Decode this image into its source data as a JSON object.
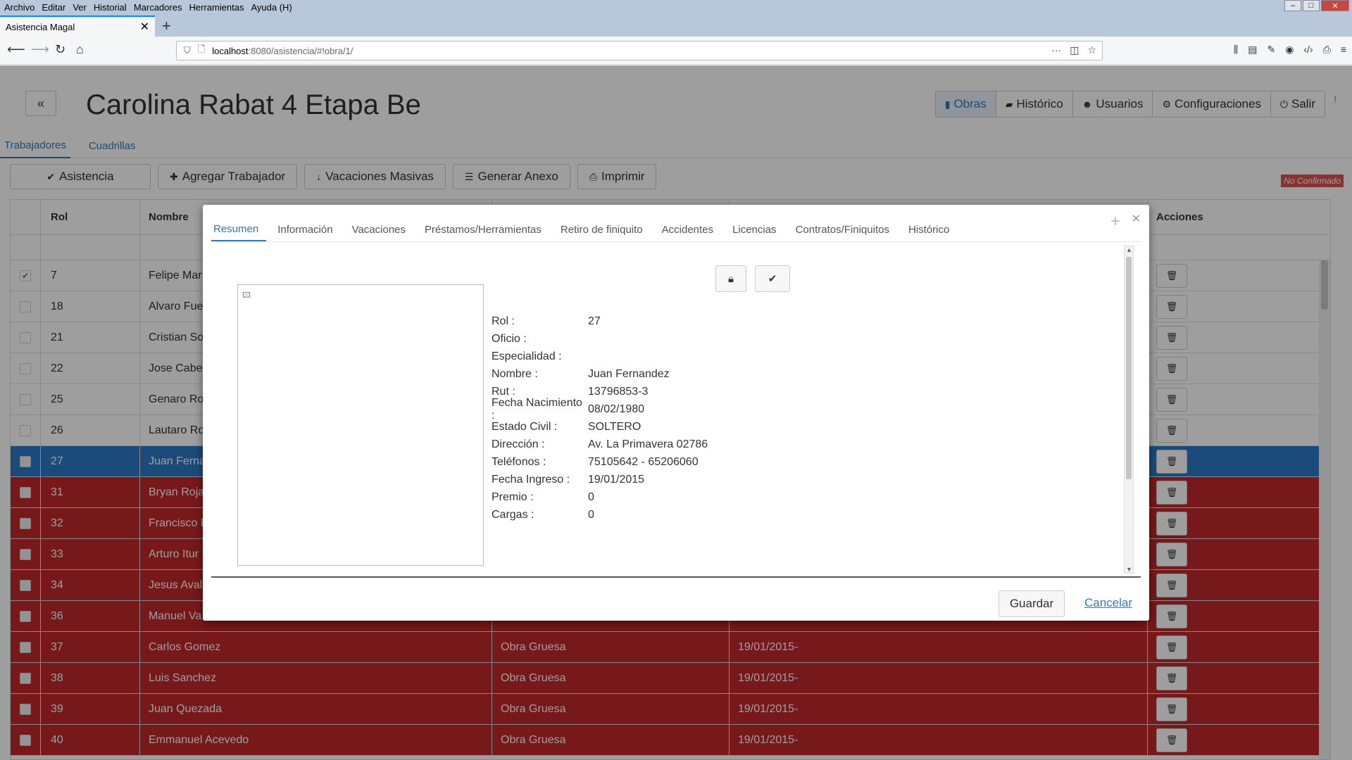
{
  "browser": {
    "menu": [
      "Archivo",
      "Editar",
      "Ver",
      "Historial",
      "Marcadores",
      "Herramientas",
      "Ayuda (H)"
    ],
    "tab_title": "Asistencia Magal",
    "url_host": "localhost",
    "url_path": ":8080/asistencia/#!obra/1/"
  },
  "page": {
    "title": "Carolina Rabat 4 Etapa Be",
    "back_label": "«",
    "nav": [
      "Obras",
      "Histórico",
      "Usuarios",
      "Configuraciones",
      "Salir"
    ],
    "alert_mark": "!",
    "subtabs": [
      "Trabajadores",
      "Cuadrillas"
    ],
    "toolbar": [
      "Asistencia",
      "Agregar Trabajador",
      "Vacaciones Masivas",
      "Generar Anexo",
      "Imprimir"
    ],
    "status_badge": "No Confirmado"
  },
  "grid": {
    "headers": [
      "Rol",
      "Nombre",
      "Acciones"
    ],
    "rows": [
      {
        "rol": "7",
        "nombre": "Felipe Mar",
        "oficio": "",
        "fecha": "",
        "state": "normal",
        "checked": true
      },
      {
        "rol": "18",
        "nombre": "Alvaro Fue",
        "oficio": "",
        "fecha": "",
        "state": "normal",
        "checked": false
      },
      {
        "rol": "21",
        "nombre": "Cristian So",
        "oficio": "",
        "fecha": "",
        "state": "normal",
        "checked": false
      },
      {
        "rol": "22",
        "nombre": "Jose Cabez",
        "oficio": "",
        "fecha": "",
        "state": "normal",
        "checked": false
      },
      {
        "rol": "25",
        "nombre": "Genaro Ro",
        "oficio": "",
        "fecha": "",
        "state": "normal",
        "checked": false
      },
      {
        "rol": "26",
        "nombre": "Lautaro Ro",
        "oficio": "",
        "fecha": "",
        "state": "normal",
        "checked": false
      },
      {
        "rol": "27",
        "nombre": "Juan Ferna",
        "oficio": "",
        "fecha": "",
        "state": "selected",
        "checked": false
      },
      {
        "rol": "31",
        "nombre": "Bryan Roja",
        "oficio": "",
        "fecha": "",
        "state": "red",
        "checked": false
      },
      {
        "rol": "32",
        "nombre": "Francisco E",
        "oficio": "",
        "fecha": "",
        "state": "red",
        "checked": false
      },
      {
        "rol": "33",
        "nombre": "Arturo Itur",
        "oficio": "",
        "fecha": "",
        "state": "red",
        "checked": false
      },
      {
        "rol": "34",
        "nombre": "Jesus Avalo",
        "oficio": "",
        "fecha": "",
        "state": "red",
        "checked": false
      },
      {
        "rol": "36",
        "nombre": "Manuel Va",
        "oficio": "",
        "fecha": "",
        "state": "red",
        "checked": false
      },
      {
        "rol": "37",
        "nombre": "Carlos Gomez",
        "oficio": "Obra Gruesa",
        "fecha": "19/01/2015-",
        "state": "red",
        "checked": false
      },
      {
        "rol": "38",
        "nombre": "Luis Sanchez",
        "oficio": "Obra Gruesa",
        "fecha": "19/01/2015-",
        "state": "red",
        "checked": false
      },
      {
        "rol": "39",
        "nombre": "Juan Quezada",
        "oficio": "Obra Gruesa",
        "fecha": "19/01/2015-",
        "state": "red",
        "checked": false
      },
      {
        "rol": "40",
        "nombre": "Emmanuel Acevedo",
        "oficio": "Obra Gruesa",
        "fecha": "19/01/2015-",
        "state": "red",
        "checked": false
      }
    ]
  },
  "modal": {
    "tabs": [
      "Resumen",
      "Información",
      "Vacaciones",
      "Préstamos/Herramientas",
      "Retiro de finiquito",
      "Accidentes",
      "Licencias",
      "Contratos/Finiquitos",
      "Histórico"
    ],
    "fields": [
      {
        "label": "Rol :",
        "value": "27"
      },
      {
        "label": "Oficio :",
        "value": ""
      },
      {
        "label": "Especialidad :",
        "value": ""
      },
      {
        "label": "Nombre :",
        "value": "Juan Fernandez"
      },
      {
        "label": "Rut :",
        "value": "13796853-3"
      },
      {
        "label": "Fecha Nacimiento :",
        "value": "08/02/1980"
      },
      {
        "label": "Estado Civil :",
        "value": "SOLTERO"
      },
      {
        "label": "Dirección :",
        "value": "Av. La Primavera 02786"
      },
      {
        "label": "Teléfonos :",
        "value": "75105642 - 65206060"
      },
      {
        "label": "Fecha Ingreso :",
        "value": "19/01/2015"
      },
      {
        "label": "Premio :",
        "value": "0"
      },
      {
        "label": "Cargas :",
        "value": "0"
      }
    ],
    "save_label": "Guardar",
    "cancel_label": "Cancelar"
  },
  "colors": {
    "accent": "#337ab7",
    "row_selected": "#2d7ac7",
    "row_unconfirmed": "#c0282a",
    "badge": "#d9534f"
  }
}
